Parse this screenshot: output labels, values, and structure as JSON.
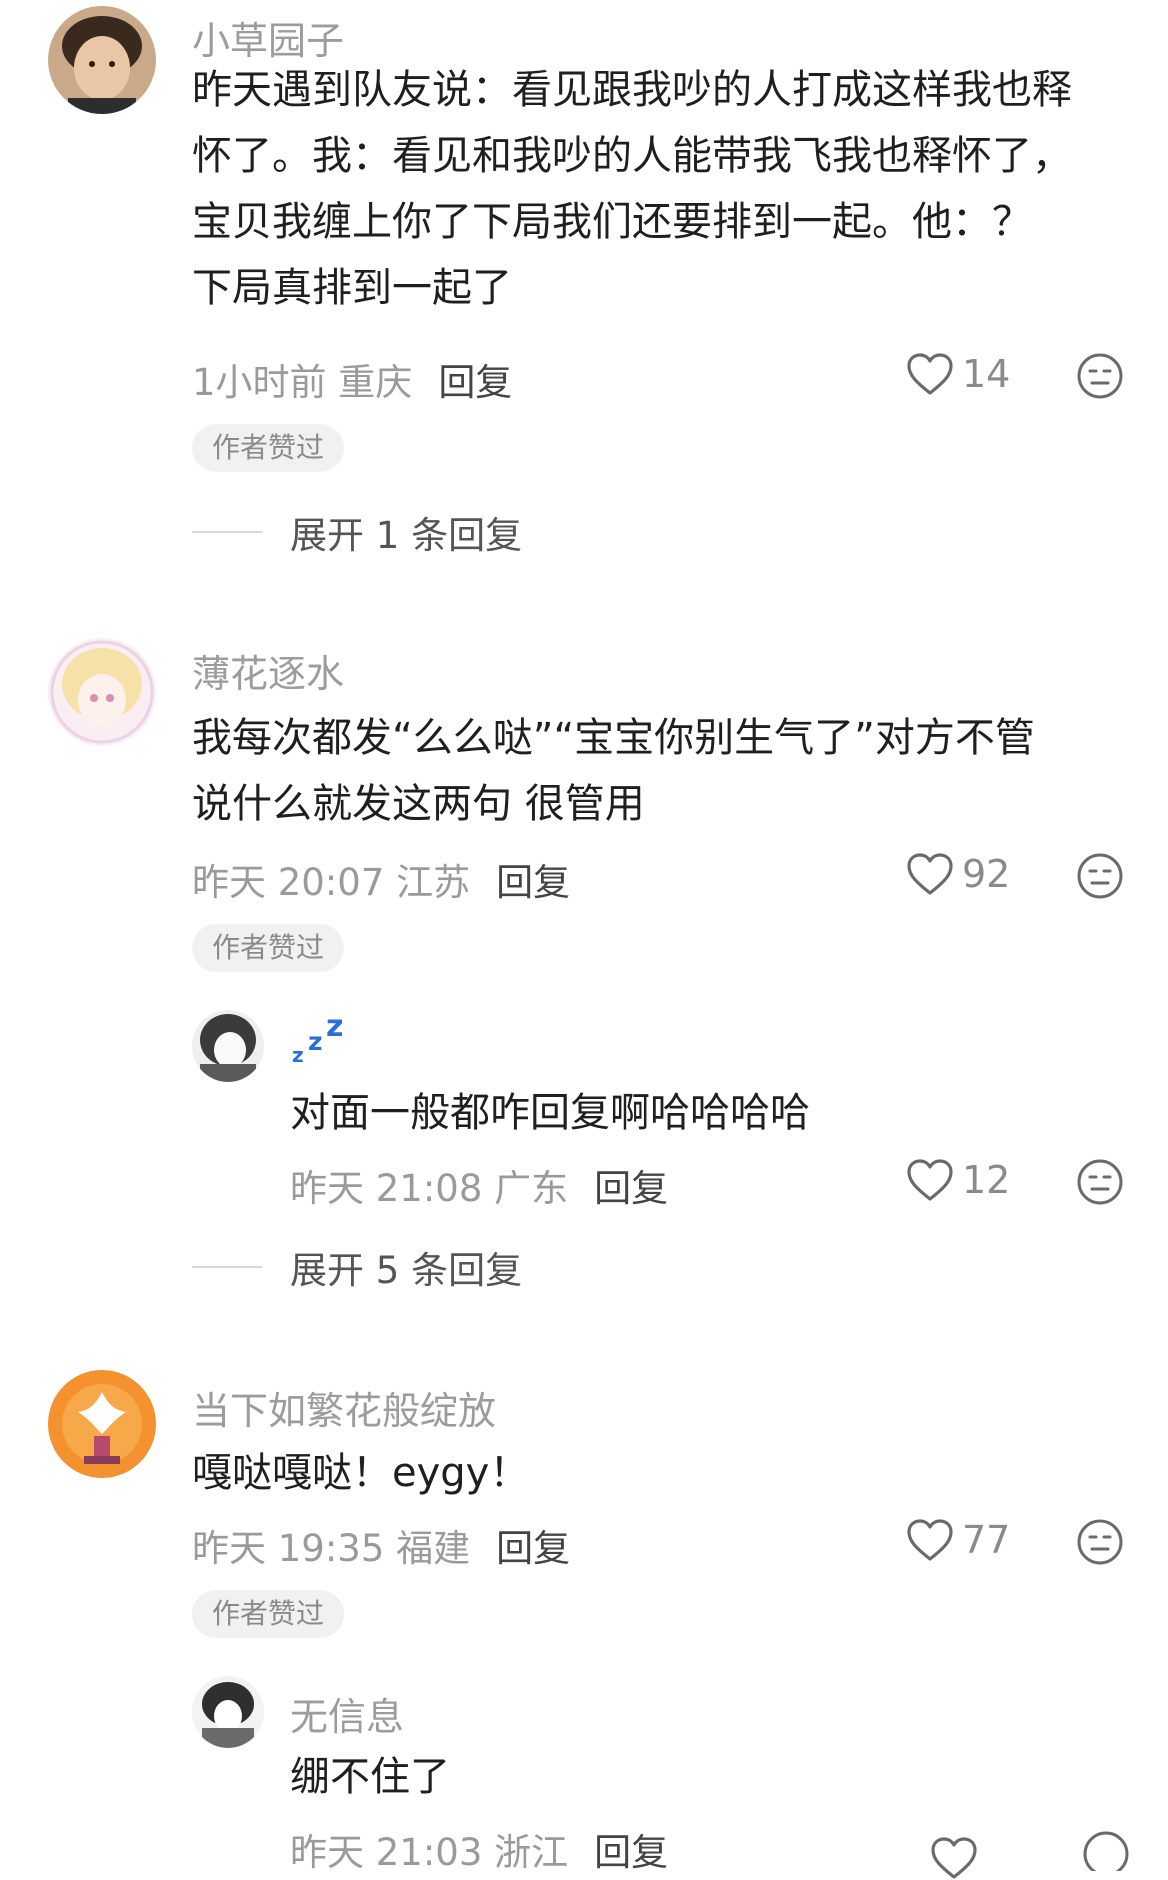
{
  "comments": [
    {
      "username": "小草园子",
      "lines": [
        "昨天遇到队友说：看见跟我吵的人打成这样我也释",
        "怀了。我：看见和我吵的人能带我飞我也释怀了，",
        "宝贝我缠上你了下局我们还要排到一起。他：？",
        "下局真排到一起了"
      ],
      "meta": "1小时前 重庆",
      "reply_label": "回复",
      "likes": "14",
      "badge": "作者赞过",
      "expand": "展开 1 条回复"
    },
    {
      "username": "薄花逐水",
      "lines": [
        "我每次都发“么么哒”“宝宝你别生气了”对方不管",
        "说什么就发这两句 很管用"
      ],
      "meta": "昨天 20:07 江苏",
      "reply_label": "回复",
      "likes": "92",
      "badge": "作者赞过",
      "reply": {
        "username": "💤",
        "text": "对面一般都咋回复啊哈哈哈哈",
        "meta": "昨天 21:08 广东",
        "reply_label": "回复",
        "likes": "12"
      },
      "expand": "展开 5 条回复"
    },
    {
      "username": "当下如繁花般绽放",
      "lines": [
        "嘎哒嘎哒！eygy！"
      ],
      "meta": "昨天 19:35 福建",
      "reply_label": "回复",
      "likes": "77",
      "badge": "作者赞过",
      "reply": {
        "username": "无信息",
        "text": "绷不住了",
        "meta": "昨天 21:03 浙江",
        "reply_label": "回复"
      }
    }
  ],
  "icons": {
    "like": "heart-outline-icon",
    "dislike": "meh-face-icon"
  },
  "colors": {
    "username": "#9c9c9c",
    "text": "#1f1f1f",
    "meta": "#9a9a9a",
    "badge_bg": "#f1f1f1",
    "zzz": "#2b6fd6"
  }
}
